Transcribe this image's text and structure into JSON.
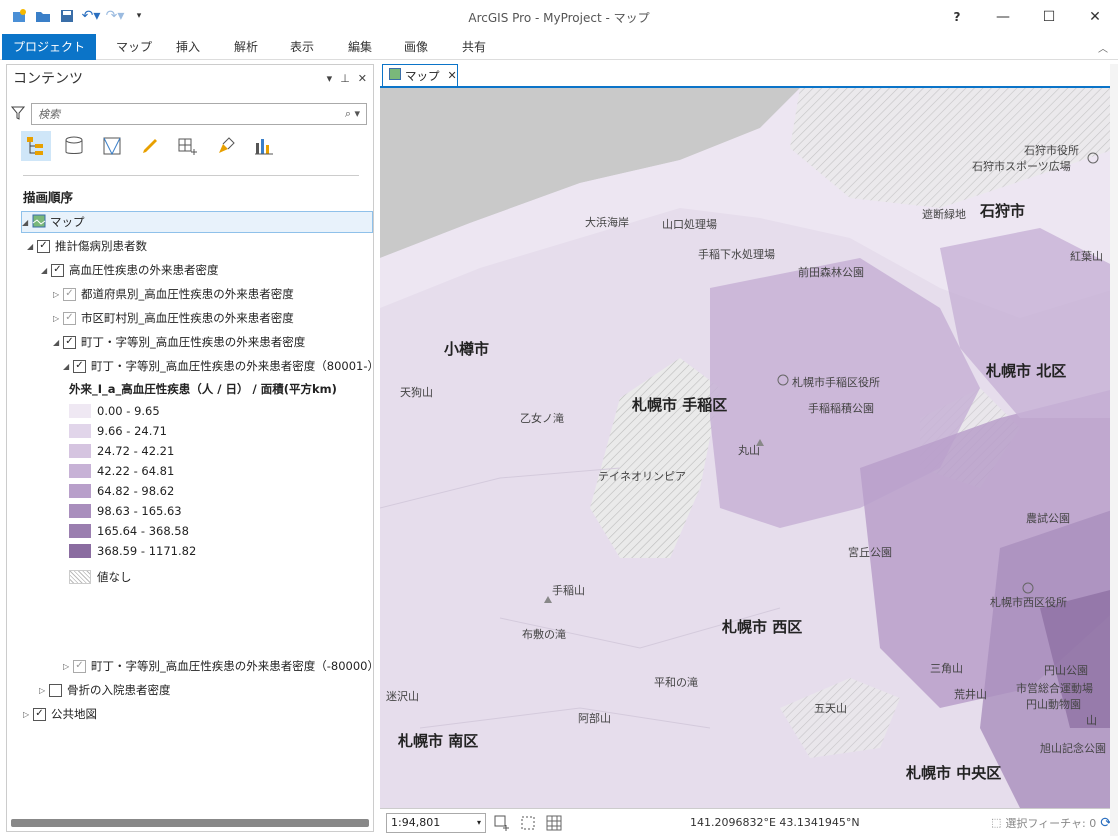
{
  "window": {
    "title": "ArcGIS Pro - MyProject - マップ",
    "help": "?"
  },
  "ribbon": {
    "tabs": [
      "プロジェクト",
      "マップ",
      "挿入",
      "解析",
      "表示",
      "編集",
      "画像",
      "共有"
    ],
    "active": "プロジェクト"
  },
  "contents": {
    "title": "コンテンツ",
    "search_placeholder": "検索",
    "section_title": "描画順序",
    "map_item": "マップ",
    "layers": {
      "group1": "推計傷病別患者数",
      "group1a": "高血圧性疾患の外来患者密度",
      "pref": "都道府県別_高血圧性疾患の外来患者密度",
      "city": "市区町村別_高血圧性疾患の外来患者密度",
      "town": "町丁・字等別_高血圧性疾患の外来患者密度",
      "town_hi": "町丁・字等別_高血圧性疾患の外来患者密度（80001-）",
      "town_lo": "町丁・字等別_高血圧性疾患の外来患者密度（-80000）",
      "group2": "骨折の入院患者密度",
      "basemap": "公共地図"
    },
    "legend": {
      "title": "外来_I_a_高血圧性疾患（人 / 日） / 面積(平方km)",
      "classes": [
        {
          "label": "0.00 - 9.65",
          "color": "#efe8f3"
        },
        {
          "label": "9.66 - 24.71",
          "color": "#e1d5ea"
        },
        {
          "label": "24.72 - 42.21",
          "color": "#d5c4e0"
        },
        {
          "label": "42.22 - 64.81",
          "color": "#c7b2d6"
        },
        {
          "label": "64.82 - 98.62",
          "color": "#b89fca"
        },
        {
          "label": "98.63 - 165.63",
          "color": "#a98ebd"
        },
        {
          "label": "165.64 - 368.58",
          "color": "#9a7eaf"
        },
        {
          "label": "368.59 - 1171.82",
          "color": "#8a6ca0"
        }
      ],
      "nodata": "値なし"
    }
  },
  "map": {
    "tab_label": "マップ",
    "labels": {
      "ishikari_office": "石狩市役所",
      "ishikari_sports": "石狩市スポーツ広場",
      "ishikari": "石狩市",
      "shadan": "遮断緑地",
      "kouyou": "紅葉山",
      "ohama": "大浜海岸",
      "yamaguchi": "山口処理場",
      "teine_water": "手稲下水処理場",
      "maeda": "前田森林公園",
      "otaru": "小樽市",
      "teine_office": "札幌市手稲区役所",
      "kita_ku": "札幌市 北区",
      "tengu": "天狗山",
      "teine_ku": "札幌市 手稲区",
      "teine_inae": "手稲稲積公園",
      "otome": "乙女ノ滝",
      "maruyama": "丸山",
      "olympia": "テイネオリンピア",
      "nouji": "農試公園",
      "miyaoka": "宮丘公園",
      "teineyama": "手稲山",
      "nishi_office": "札幌市西区役所",
      "fusuma": "布敷の滝",
      "nishi_ku": "札幌市 西区",
      "sankaku": "三角山",
      "maruyama_park": "円山公園",
      "sport_ground": "市営総合運動場",
      "zoo": "円山動物園",
      "heiwa": "平和の滝",
      "arai": "荒井山",
      "meisawa": "迷沢山",
      "goten": "五天山",
      "abe": "阿部山",
      "minami_ku": "札幌市 南区",
      "asahi": "旭山記念公園",
      "chuo_ku": "札幌市 中央区",
      "yama": "山"
    }
  },
  "status": {
    "scale": "1:94,801",
    "coords": "141.2096832°E 43.1341945°N",
    "selected": "選択フィーチャ: 0"
  }
}
